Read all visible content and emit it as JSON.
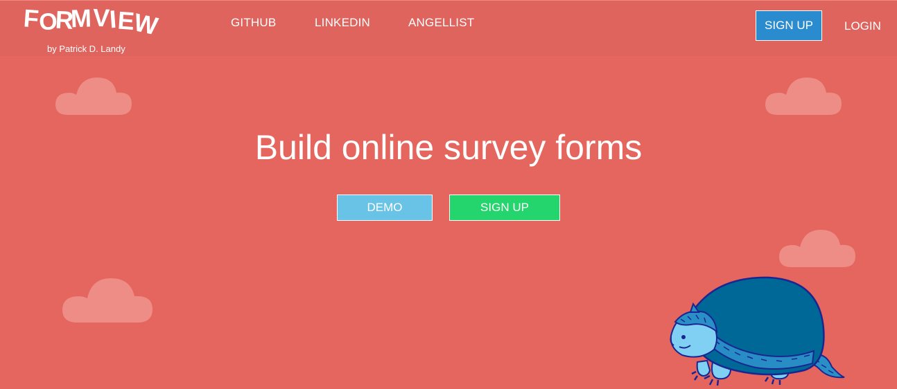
{
  "brand": {
    "logo_text": "FORMVIEW",
    "byline": "by Patrick D. Landy"
  },
  "nav": {
    "links": [
      "GITHUB",
      "LINKEDIN",
      "ANGELLIST"
    ],
    "signup_label": "SIGN UP",
    "login_label": "LOGIN"
  },
  "hero": {
    "title": "Build online survey forms",
    "demo_label": "DEMO",
    "signup_label": "SIGN UP"
  },
  "colors": {
    "background": "#e5665e",
    "navbar": "#de645d",
    "nav_signup_button": "#2a8bcf",
    "demo_button": "#68c3e7",
    "signup_button": "#24d46c",
    "cloud": "#ee8c86"
  },
  "decorations": {
    "cloud_icon": "cloud-icon",
    "mascot": "armadillo-illustration"
  }
}
